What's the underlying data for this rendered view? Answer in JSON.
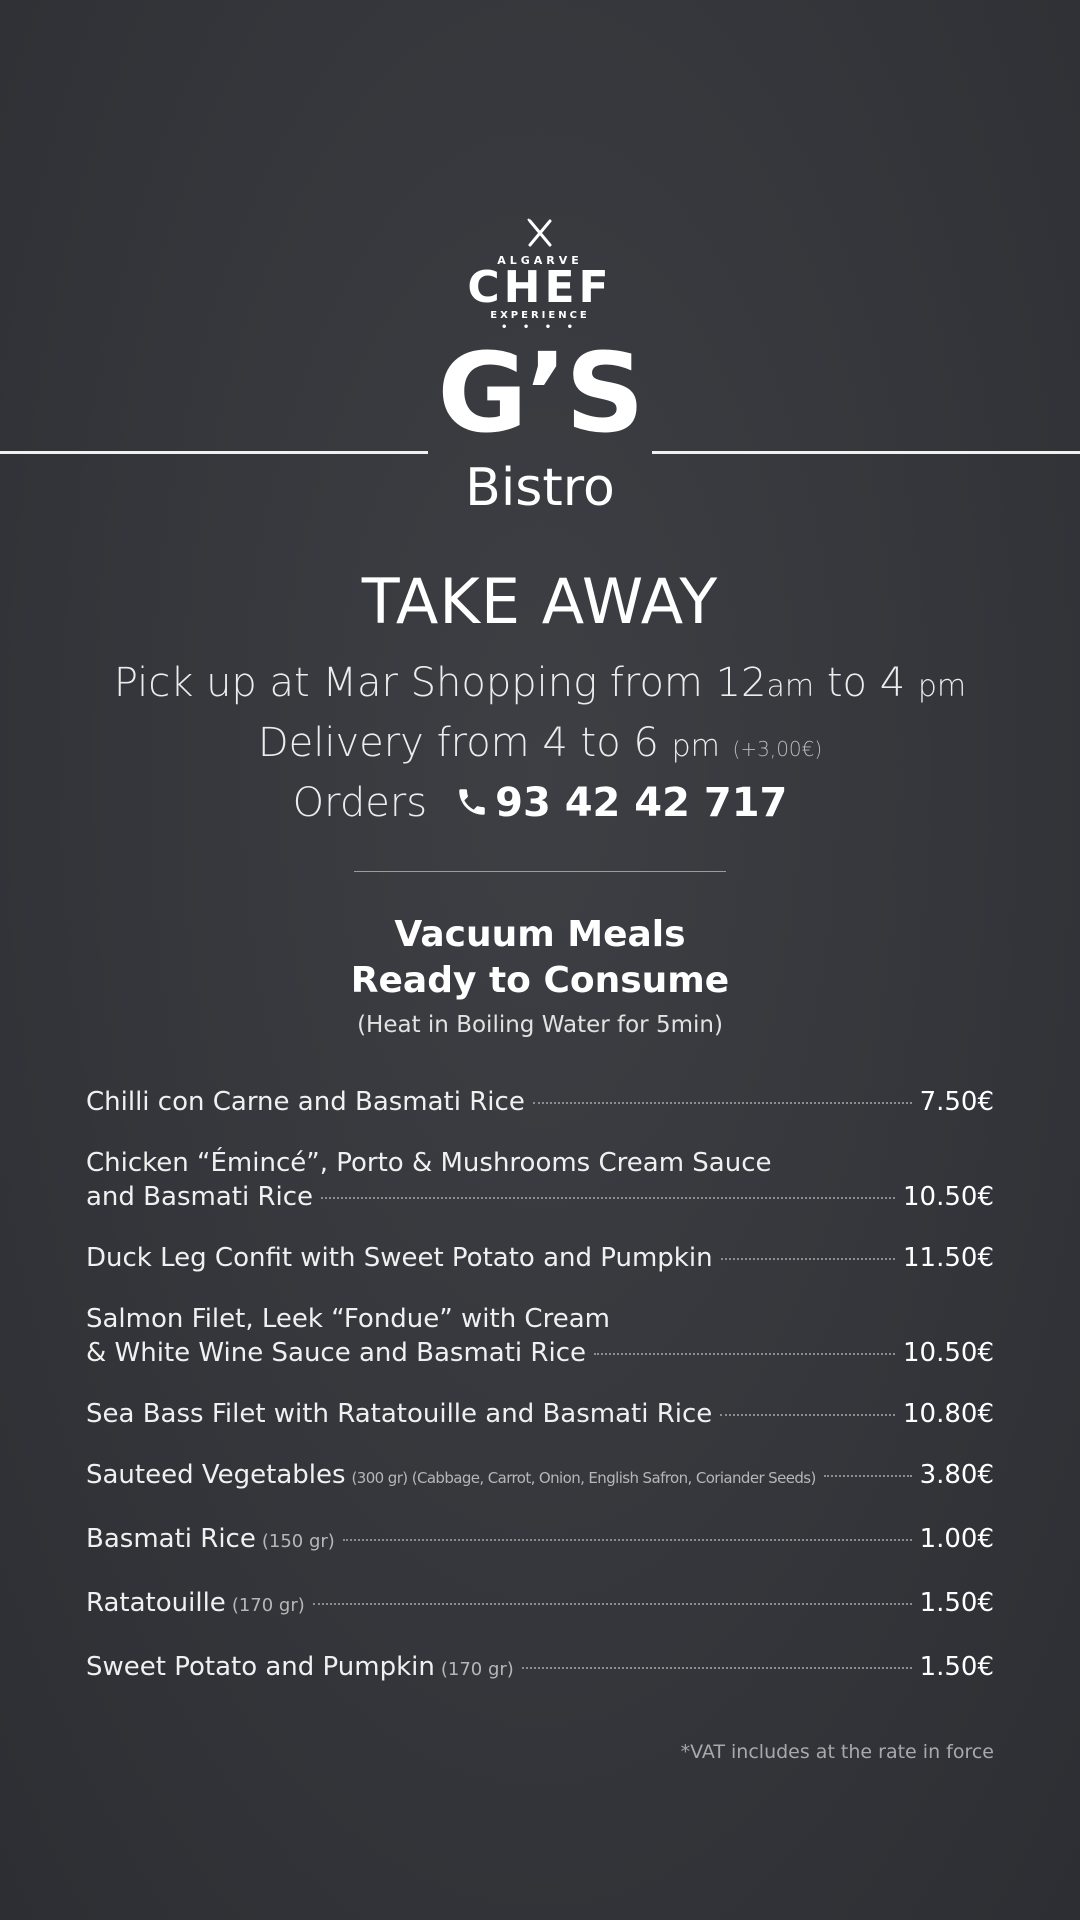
{
  "logo": {
    "icon": "fork-knife-icon",
    "algarve": "ALGARVE",
    "chef": "CHEF",
    "experience": "EXPERIENCE",
    "dots": "• • • •",
    "gs": "G’S",
    "bistro": "Bistro"
  },
  "heading": "TAKE AWAY",
  "pickup": {
    "text": "Pick up at Mar Shopping from 12",
    "am": "am",
    "to": " to 4 ",
    "pm": "pm"
  },
  "delivery": {
    "text": "Delivery from 4 to 6 ",
    "pm": "pm",
    "fee": "(+3,00€)"
  },
  "orders": {
    "label": "Orders",
    "icon": "phone-icon",
    "phone": "93 42 42 717"
  },
  "section": {
    "title_1": "Vacuum Meals",
    "title_2": "Ready to Consume",
    "subtitle": "(Heat in Boiling Water for 5min)"
  },
  "items": [
    {
      "line1": "",
      "name": "Chilli con Carne and Basmati Rice",
      "note": "",
      "price": "7.50€"
    },
    {
      "line1": "Chicken “Émincé”, Porto & Mushrooms Cream Sauce",
      "name": "and Basmati Rice",
      "note": "",
      "price": "10.50€"
    },
    {
      "line1": "",
      "name": "Duck Leg Confit with Sweet Potato and Pumpkin",
      "note": "",
      "price": "11.50€"
    },
    {
      "line1": "Salmon Filet, Leek “Fondue” with Cream",
      "name": "& White Wine Sauce and Basmati Rice",
      "note": "",
      "price": "10.50€"
    },
    {
      "line1": "",
      "name": "Sea Bass Filet with Ratatouille and Basmati Rice",
      "note": "",
      "price": "10.80€"
    },
    {
      "line1": "",
      "name": "Sauteed Vegetables",
      "note": "(300 gr) (Cabbage, Carrot, Onion, English Safron, Coriander Seeds)",
      "price": "3.80€"
    },
    {
      "line1": "",
      "name": "Basmati Rice",
      "note": "(150 gr)",
      "price": "1.00€"
    },
    {
      "line1": "",
      "name": "Ratatouille",
      "note": "(170 gr)",
      "price": "1.50€"
    },
    {
      "line1": "",
      "name": "Sweet Potato and Pumpkin",
      "note": "(170 gr)",
      "price": "1.50€"
    }
  ],
  "vat_note": "*VAT includes at the rate in force"
}
